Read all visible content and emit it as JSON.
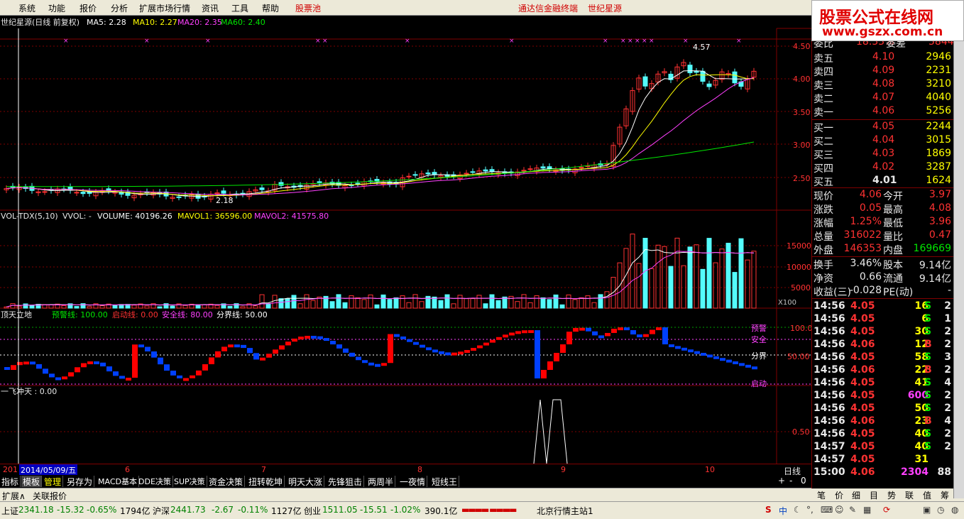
{
  "menu": {
    "items": [
      "系统",
      "功能",
      "报价",
      "分析",
      "扩展市场行情",
      "资讯",
      "工具",
      "帮助"
    ],
    "pool": "股票池",
    "ad1": "通达信金融终端",
    "ad2": "世纪星源"
  },
  "logo": {
    "line1": "股票公式在线网",
    "line2": "www.gszx.com.cn"
  },
  "main_header": {
    "title": "世纪星源(日线 前复权)",
    "ma5": "MA5: 2.28",
    "ma10": "MA10: 2.27",
    "ma20": "MA20: 2.35",
    "ma60": "MA60: 2.40"
  },
  "price_axis": [
    "4.50",
    "4.00",
    "3.50",
    "3.00",
    "2.50"
  ],
  "price_labels": {
    "high": "4.57",
    "low": "2.18"
  },
  "vol_header": {
    "name": "VOL-TDX(5,10)",
    "vvol": "VVOL: -",
    "volume": "VOLUME: 40196.26",
    "mavol1": "MAVOL1: 36596.00",
    "mavol2": "MAVOL2: 41575.80"
  },
  "vol_axis": [
    "15000",
    "10000",
    "5000"
  ],
  "vol_unit": "X100",
  "ind1_header": {
    "name": "顶天立地",
    "warn": "预警线: 100.00",
    "start": "启动线: 0.00",
    "safe": "安全线: 80.00",
    "divide": "分界线: 50.00"
  },
  "ind1_axis": [
    "100.0",
    "50.00"
  ],
  "ind1_labels": {
    "warn": "预警",
    "safe": "安全",
    "divide": "分界",
    "start": "启动"
  },
  "ind2_header": {
    "name": "一飞冲天 : 0.00"
  },
  "ind2_axis": [
    "0.50"
  ],
  "date_axis": {
    "first": "201",
    "cursor": "2014/05/09/五",
    "months": [
      "6",
      "7",
      "8",
      "9",
      "10"
    ],
    "period": "日线"
  },
  "tabs": [
    "指标",
    "模板",
    "管理",
    "另存为",
    "MACD基本",
    "DDE决策",
    "SUP决策",
    "资金决策",
    "扭转乾坤",
    "明天大涨",
    "先锋狙击",
    "两周半",
    "一夜情",
    "短线王"
  ],
  "bottom_left": [
    "扩展∧",
    "关联报价"
  ],
  "right_tabs": [
    "笔",
    "价",
    "细",
    "目",
    "势",
    "联",
    "值",
    "筹"
  ],
  "quote": {
    "top_cut": [
      "委比",
      "18.33%",
      "委差",
      "5844"
    ],
    "asks": [
      [
        "卖五",
        "4.10",
        "2946"
      ],
      [
        "卖四",
        "4.09",
        "2231"
      ],
      [
        "卖三",
        "4.08",
        "3210"
      ],
      [
        "卖二",
        "4.07",
        "4040"
      ],
      [
        "卖一",
        "4.06",
        "5256"
      ]
    ],
    "bids": [
      [
        "买一",
        "4.05",
        "2244"
      ],
      [
        "买二",
        "4.04",
        "3015"
      ],
      [
        "买三",
        "4.03",
        "1869"
      ],
      [
        "买四",
        "4.02",
        "3287"
      ],
      [
        "买五",
        "4.01",
        "1624"
      ]
    ],
    "stats": [
      [
        "现价",
        "4.06",
        "今开",
        "3.97"
      ],
      [
        "涨跌",
        "0.05",
        "最高",
        "4.08"
      ],
      [
        "涨幅",
        "1.25%",
        "最低",
        "3.96"
      ],
      [
        "总量",
        "316022",
        "量比",
        "0.47"
      ],
      [
        "外盘",
        "146353",
        "内盘",
        "169669"
      ]
    ],
    "stats2": [
      [
        "换手",
        "3.46%",
        "股本",
        "9.14亿"
      ],
      [
        "净资",
        "0.66",
        "流通",
        "9.14亿"
      ],
      [
        "收益(三)",
        "-0.028",
        "PE(动)",
        "-"
      ]
    ],
    "ticks": [
      [
        "14:56",
        "4.05",
        "16",
        "S",
        "2"
      ],
      [
        "14:56",
        "4.05",
        "6",
        "S",
        "1"
      ],
      [
        "14:56",
        "4.05",
        "30",
        "S",
        "2"
      ],
      [
        "14:56",
        "4.06",
        "12",
        "B",
        "2"
      ],
      [
        "14:56",
        "4.05",
        "58",
        "S",
        "3"
      ],
      [
        "14:56",
        "4.06",
        "22",
        "B",
        "2"
      ],
      [
        "14:56",
        "4.05",
        "41",
        "S",
        "4"
      ],
      [
        "14:56",
        "4.05",
        "600",
        "S",
        "2"
      ],
      [
        "14:56",
        "4.05",
        "50",
        "S",
        "2"
      ],
      [
        "14:56",
        "4.06",
        "23",
        "B",
        "4"
      ],
      [
        "14:56",
        "4.05",
        "40",
        "S",
        "2"
      ],
      [
        "14:57",
        "4.05",
        "40",
        "S",
        "2"
      ],
      [
        "14:57",
        "4.05",
        "31",
        "",
        ""
      ],
      [
        "15:00",
        "4.06",
        "2304",
        "",
        "88"
      ]
    ]
  },
  "status": {
    "sh_name": "上证",
    "sh_val": "2341.18",
    "sh_chg": "-15.32",
    "sh_pct": "-0.65%",
    "sh_amt": "1794亿",
    "sz_name": "沪深",
    "sz_val": "2441.73",
    "sz_chg": "-2.67",
    "sz_pct": "-0.11%",
    "sz_amt": "1127亿",
    "cy_name": "创业",
    "cy_val": "1511.05",
    "cy_chg": "-15.51",
    "cy_pct": "-1.02%",
    "cy_amt": "390.1亿",
    "server": "北京行情主站1"
  },
  "colors": {
    "up": "#ff3232",
    "down": "#54fcfc",
    "ma5": "#ffffff",
    "ma10": "#ffff00",
    "ma20": "#ff40ff",
    "ma60": "#00e600"
  }
}
